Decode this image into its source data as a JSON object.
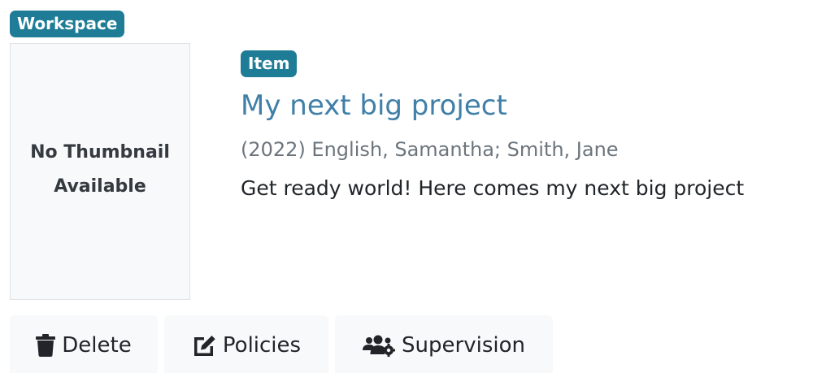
{
  "workspace_badge": "Workspace",
  "item_badge": "Item",
  "thumbnail": {
    "line1": "No Thumbnail",
    "line2": "Available"
  },
  "title": "My next big project",
  "meta": "(2022) English, Samantha; Smith, Jane",
  "description": "Get ready world! Here comes my next big project",
  "actions": [
    {
      "label": "Delete",
      "icon": "trash-icon"
    },
    {
      "label": "Policies",
      "icon": "edit-icon"
    },
    {
      "label": "Supervision",
      "icon": "users-cog-icon"
    }
  ],
  "colors": {
    "badge": "#1e7c96",
    "title": "#3f7fa8",
    "meta": "#6c757d",
    "button_bg": "#f8f9fa"
  }
}
